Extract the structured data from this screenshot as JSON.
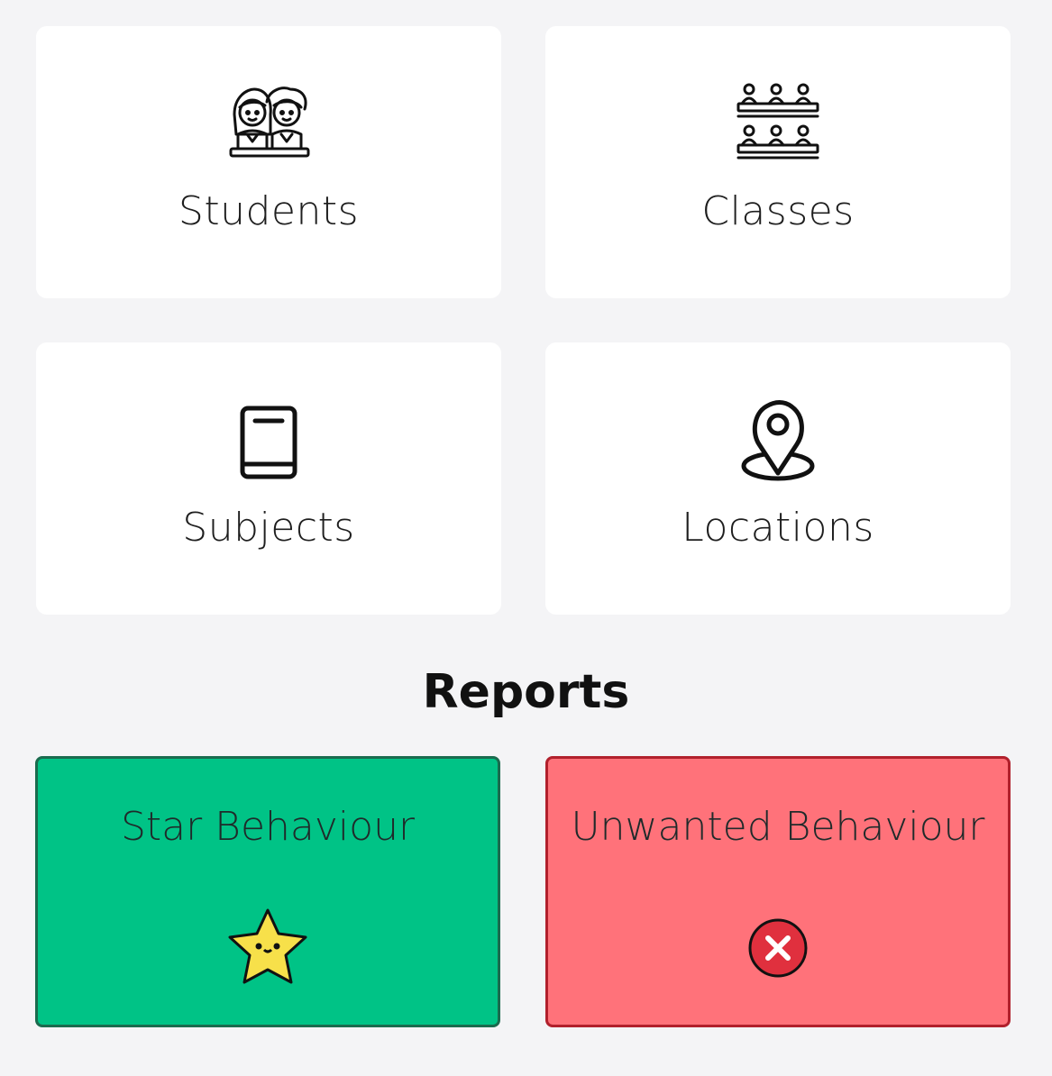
{
  "cards": {
    "students": {
      "label": "Students",
      "icon": "students-icon"
    },
    "classes": {
      "label": "Classes",
      "icon": "classroom-icon"
    },
    "subjects": {
      "label": "Subjects",
      "icon": "book-icon"
    },
    "locations": {
      "label": "Locations",
      "icon": "location-pin-icon"
    }
  },
  "reports": {
    "title": "Reports",
    "star": {
      "label": "Star Behaviour",
      "icon": "star-icon",
      "color": "#00c386"
    },
    "unwanted": {
      "label": "Unwanted Behaviour",
      "icon": "cross-icon",
      "color": "#ff727a"
    }
  }
}
